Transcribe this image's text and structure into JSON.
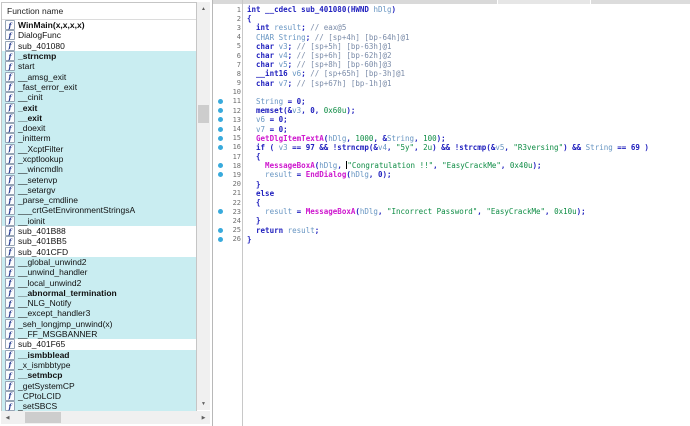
{
  "colors": {
    "library_row_bg": "#C9EDF1",
    "keyword": "#2121BE",
    "variable": "#6795C2",
    "comment": "#7A8BA8",
    "literal_green": "#0E8C44",
    "import_magenta": "#CE17CE",
    "line_number": "#707070",
    "address_dot": "#38AADC"
  },
  "functions_panel": {
    "header_label": "Function name",
    "items": [
      {
        "name": "WinMain(x,x,x,x)",
        "bold": true,
        "lib": false
      },
      {
        "name": "DialogFunc",
        "bold": false,
        "lib": false
      },
      {
        "name": "sub_401080",
        "bold": false,
        "lib": false
      },
      {
        "name": "_strncmp",
        "bold": true,
        "lib": true
      },
      {
        "name": "start",
        "bold": false,
        "lib": true
      },
      {
        "name": "__amsg_exit",
        "bold": false,
        "lib": true
      },
      {
        "name": "_fast_error_exit",
        "bold": false,
        "lib": true
      },
      {
        "name": "__cinit",
        "bold": false,
        "lib": true
      },
      {
        "name": "_exit",
        "bold": true,
        "lib": true
      },
      {
        "name": "__exit",
        "bold": true,
        "lib": true
      },
      {
        "name": "_doexit",
        "bold": false,
        "lib": true
      },
      {
        "name": "_initterm",
        "bold": false,
        "lib": true
      },
      {
        "name": "__XcptFilter",
        "bold": false,
        "lib": true
      },
      {
        "name": "_xcptlookup",
        "bold": false,
        "lib": true
      },
      {
        "name": "__wincmdln",
        "bold": false,
        "lib": true
      },
      {
        "name": "__setenvp",
        "bold": false,
        "lib": true
      },
      {
        "name": "__setargv",
        "bold": false,
        "lib": true
      },
      {
        "name": "_parse_cmdline",
        "bold": false,
        "lib": true
      },
      {
        "name": "___crtGetEnvironmentStringsA",
        "bold": false,
        "lib": true
      },
      {
        "name": "__ioinit",
        "bold": false,
        "lib": true
      },
      {
        "name": "sub_401B88",
        "bold": false,
        "lib": false
      },
      {
        "name": "sub_401BB5",
        "bold": false,
        "lib": false
      },
      {
        "name": "sub_401CFD",
        "bold": false,
        "lib": false
      },
      {
        "name": "__global_unwind2",
        "bold": false,
        "lib": true
      },
      {
        "name": "__unwind_handler",
        "bold": false,
        "lib": true
      },
      {
        "name": "__local_unwind2",
        "bold": false,
        "lib": true
      },
      {
        "name": "__abnormal_termination",
        "bold": true,
        "lib": true
      },
      {
        "name": "__NLG_Notify",
        "bold": false,
        "lib": true
      },
      {
        "name": "__except_handler3",
        "bold": false,
        "lib": true
      },
      {
        "name": "_seh_longjmp_unwind(x)",
        "bold": false,
        "lib": true
      },
      {
        "name": "__FF_MSGBANNER",
        "bold": false,
        "lib": true
      },
      {
        "name": "sub_401F65",
        "bold": false,
        "lib": false
      },
      {
        "name": "__ismbblead",
        "bold": true,
        "lib": true
      },
      {
        "name": "_x_ismbbtype",
        "bold": false,
        "lib": true
      },
      {
        "name": "__setmbcp",
        "bold": true,
        "lib": true
      },
      {
        "name": "_getSystemCP",
        "bold": false,
        "lib": true
      },
      {
        "name": "_CPtoLCID",
        "bold": false,
        "lib": true
      },
      {
        "name": "_setSBCS",
        "bold": false,
        "lib": true
      }
    ]
  },
  "code_panel": {
    "lines": [
      {
        "num": 1,
        "dot": false,
        "segments": [
          [
            "k",
            "int __cdecl sub_401080(HWND "
          ],
          [
            "v",
            "hDlg"
          ],
          [
            "k",
            ")"
          ]
        ]
      },
      {
        "num": 2,
        "dot": false,
        "segments": [
          [
            "k",
            "{"
          ]
        ]
      },
      {
        "num": 3,
        "dot": false,
        "segments": [
          [
            "k",
            "  int "
          ],
          [
            "v",
            "result"
          ],
          [
            "k",
            "; "
          ],
          [
            "c",
            "// eax@5"
          ]
        ]
      },
      {
        "num": 4,
        "dot": false,
        "segments": [
          [
            "v",
            "  CHAR String"
          ],
          [
            "k",
            "; "
          ],
          [
            "c",
            "// [sp+4h] [bp-64h]@1"
          ]
        ]
      },
      {
        "num": 5,
        "dot": false,
        "segments": [
          [
            "k",
            "  char "
          ],
          [
            "v",
            "v3"
          ],
          [
            "k",
            "; "
          ],
          [
            "c",
            "// [sp+5h] [bp-63h]@1"
          ]
        ]
      },
      {
        "num": 6,
        "dot": false,
        "segments": [
          [
            "k",
            "  char "
          ],
          [
            "v",
            "v4"
          ],
          [
            "k",
            "; "
          ],
          [
            "c",
            "// [sp+6h] [bp-62h]@2"
          ]
        ]
      },
      {
        "num": 7,
        "dot": false,
        "segments": [
          [
            "k",
            "  char "
          ],
          [
            "v",
            "v5"
          ],
          [
            "k",
            "; "
          ],
          [
            "c",
            "// [sp+8h] [bp-60h]@3"
          ]
        ]
      },
      {
        "num": 8,
        "dot": false,
        "segments": [
          [
            "k",
            "  __int16 "
          ],
          [
            "v",
            "v6"
          ],
          [
            "k",
            "; "
          ],
          [
            "c",
            "// [sp+65h] [bp-3h]@1"
          ]
        ]
      },
      {
        "num": 9,
        "dot": false,
        "segments": [
          [
            "k",
            "  char "
          ],
          [
            "v",
            "v7"
          ],
          [
            "k",
            "; "
          ],
          [
            "c",
            "// [sp+67h] [bp-1h]@1"
          ]
        ]
      },
      {
        "num": 10,
        "dot": false,
        "segments": []
      },
      {
        "num": 11,
        "dot": true,
        "segments": [
          [
            "v",
            "  String"
          ],
          [
            "k",
            " = 0;"
          ]
        ]
      },
      {
        "num": 12,
        "dot": true,
        "segments": [
          [
            "k",
            "  memset(&"
          ],
          [
            "v",
            "v3"
          ],
          [
            "k",
            ", 0, "
          ],
          [
            "g",
            "0x60u"
          ],
          [
            "k",
            ");"
          ]
        ]
      },
      {
        "num": 13,
        "dot": true,
        "segments": [
          [
            "v",
            "  v6"
          ],
          [
            "k",
            " = 0;"
          ]
        ]
      },
      {
        "num": 14,
        "dot": true,
        "segments": [
          [
            "v",
            "  v7"
          ],
          [
            "k",
            " = 0;"
          ]
        ]
      },
      {
        "num": 15,
        "dot": true,
        "segments": [
          [
            "m",
            "  GetDlgItemTextA"
          ],
          [
            "k",
            "("
          ],
          [
            "v",
            "hDlg"
          ],
          [
            "k",
            ", "
          ],
          [
            "g",
            "1000"
          ],
          [
            "k",
            ", &"
          ],
          [
            "v",
            "String"
          ],
          [
            "k",
            ", "
          ],
          [
            "g",
            "100"
          ],
          [
            "k",
            ");"
          ]
        ]
      },
      {
        "num": 16,
        "dot": true,
        "segments": [
          [
            "k",
            "  if ( "
          ],
          [
            "v",
            "v3"
          ],
          [
            "k",
            " == 97 && !strncmp(&"
          ],
          [
            "v",
            "v4"
          ],
          [
            "k",
            ", "
          ],
          [
            "g",
            "\"5y\""
          ],
          [
            "k",
            ", "
          ],
          [
            "g",
            "2u"
          ],
          [
            "k",
            ") && !strcmp(&"
          ],
          [
            "v",
            "v5"
          ],
          [
            "k",
            ", "
          ],
          [
            "g",
            "\"R3versing\""
          ],
          [
            "k",
            ") && "
          ],
          [
            "v",
            "String"
          ],
          [
            "k",
            " == 69 )"
          ]
        ]
      },
      {
        "num": 17,
        "dot": false,
        "segments": [
          [
            "k",
            "  {"
          ]
        ]
      },
      {
        "num": 18,
        "dot": true,
        "segments": [
          [
            "m",
            "    MessageBoxA"
          ],
          [
            "k",
            "("
          ],
          [
            "v",
            "hDlg"
          ],
          [
            "k",
            ", "
          ],
          [
            "caret",
            ""
          ],
          [
            "g",
            "\"Congratulation !!\""
          ],
          [
            "k",
            ", "
          ],
          [
            "g",
            "\"EasyCrackMe\""
          ],
          [
            "k",
            ", "
          ],
          [
            "g",
            "0x40u"
          ],
          [
            "k",
            ");"
          ]
        ]
      },
      {
        "num": 19,
        "dot": true,
        "segments": [
          [
            "v",
            "    result"
          ],
          [
            "k",
            " = "
          ],
          [
            "m",
            "EndDialog"
          ],
          [
            "k",
            "("
          ],
          [
            "v",
            "hDlg"
          ],
          [
            "k",
            ", 0);"
          ]
        ]
      },
      {
        "num": 20,
        "dot": false,
        "segments": [
          [
            "k",
            "  }"
          ]
        ]
      },
      {
        "num": 21,
        "dot": false,
        "segments": [
          [
            "k",
            "  else"
          ]
        ]
      },
      {
        "num": 22,
        "dot": false,
        "segments": [
          [
            "k",
            "  {"
          ]
        ]
      },
      {
        "num": 23,
        "dot": true,
        "segments": [
          [
            "v",
            "    result"
          ],
          [
            "k",
            " = "
          ],
          [
            "m",
            "MessageBoxA"
          ],
          [
            "k",
            "("
          ],
          [
            "v",
            "hDlg"
          ],
          [
            "k",
            ", "
          ],
          [
            "g",
            "\"Incorrect Password\""
          ],
          [
            "k",
            ", "
          ],
          [
            "g",
            "\"EasyCrackMe\""
          ],
          [
            "k",
            ", "
          ],
          [
            "g",
            "0x10u"
          ],
          [
            "k",
            ");"
          ]
        ]
      },
      {
        "num": 24,
        "dot": false,
        "segments": [
          [
            "k",
            "  }"
          ]
        ]
      },
      {
        "num": 25,
        "dot": true,
        "segments": [
          [
            "k",
            "  return "
          ],
          [
            "v",
            "result"
          ],
          [
            "k",
            ";"
          ]
        ]
      },
      {
        "num": 26,
        "dot": true,
        "segments": [
          [
            "k",
            "}"
          ]
        ]
      }
    ]
  },
  "scrollbars": {
    "up_glyph": "▲",
    "down_glyph": "▼",
    "left_glyph": "◀",
    "right_glyph": "▶"
  }
}
